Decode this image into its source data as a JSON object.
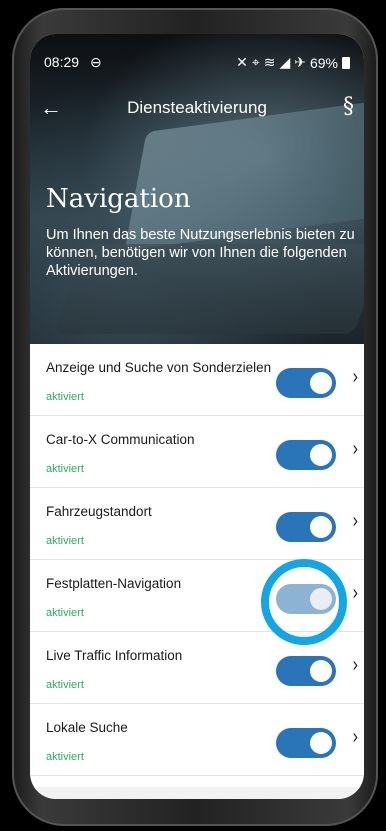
{
  "statusbar": {
    "time": "08:29",
    "alarm_icon": "⊖",
    "battery_percent": "69%",
    "icons": [
      "mute-icon",
      "location-icon",
      "wifi-icon",
      "signal-icon",
      "signal-icon",
      "airplane-icon"
    ]
  },
  "appbar": {
    "back_glyph": "←",
    "title": "Diensteaktivierung",
    "legal_glyph": "§"
  },
  "hero": {
    "title": "Navigation",
    "text": "Um Ihnen das beste Nutzungserlebnis bieten zu können, benötigen wir von Ihnen die folgenden Aktivierungen."
  },
  "services": [
    {
      "title": "Anzeige und Suche von Sonderzielen",
      "status": "aktiviert",
      "enabled": true
    },
    {
      "title": "Car-to-X Communication",
      "status": "aktiviert",
      "enabled": true
    },
    {
      "title": "Fahrzeugstandort",
      "status": "aktiviert",
      "enabled": true
    },
    {
      "title": "Festplatten-Navigation",
      "status": "aktiviert",
      "enabled": true
    },
    {
      "title": "Live Traffic Information",
      "status": "aktiviert",
      "enabled": true
    },
    {
      "title": "Lokale Suche",
      "status": "aktiviert",
      "enabled": true
    }
  ],
  "chevron": "›",
  "colors": {
    "toggle_on": "#2a74b8",
    "status_green": "#2fa866",
    "highlight": "#13a6e6"
  }
}
